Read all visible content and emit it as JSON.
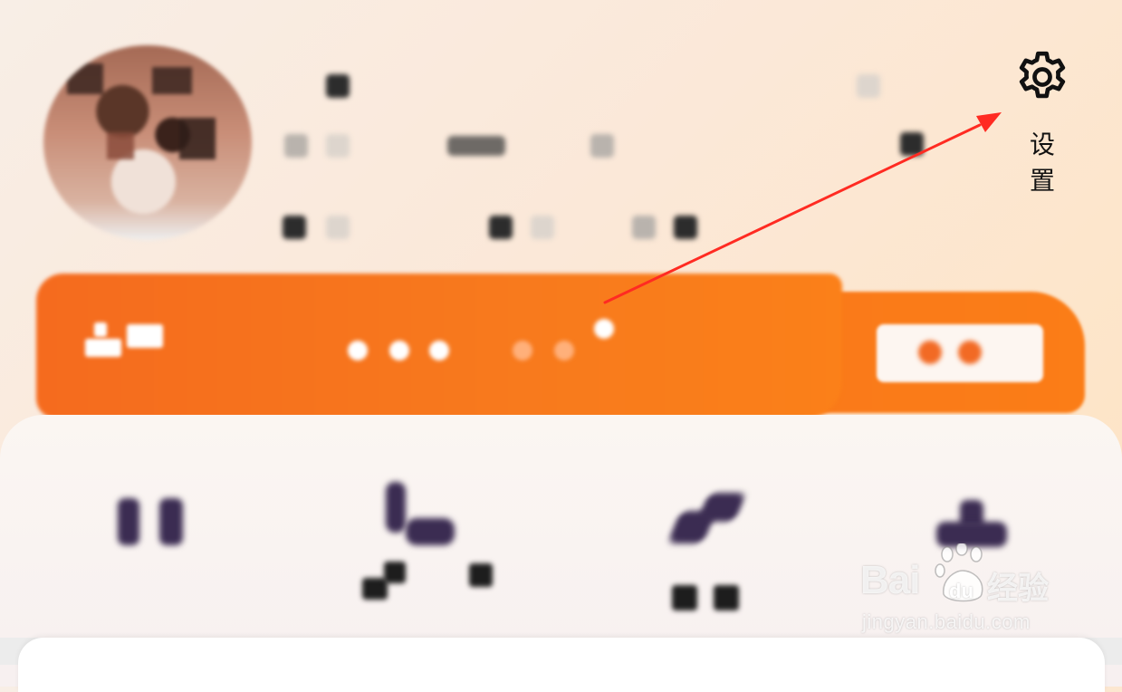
{
  "header": {
    "settings": {
      "label": "设 置",
      "icon": "gear-icon"
    }
  },
  "banner": {
    "color": "#f7761c"
  },
  "annotation": {
    "arrow_color": "#ff2b22"
  },
  "watermark": {
    "brand_latin": "Bai",
    "brand_du": "du",
    "brand_cn": "经验",
    "url": "jingyan.baidu.com"
  }
}
